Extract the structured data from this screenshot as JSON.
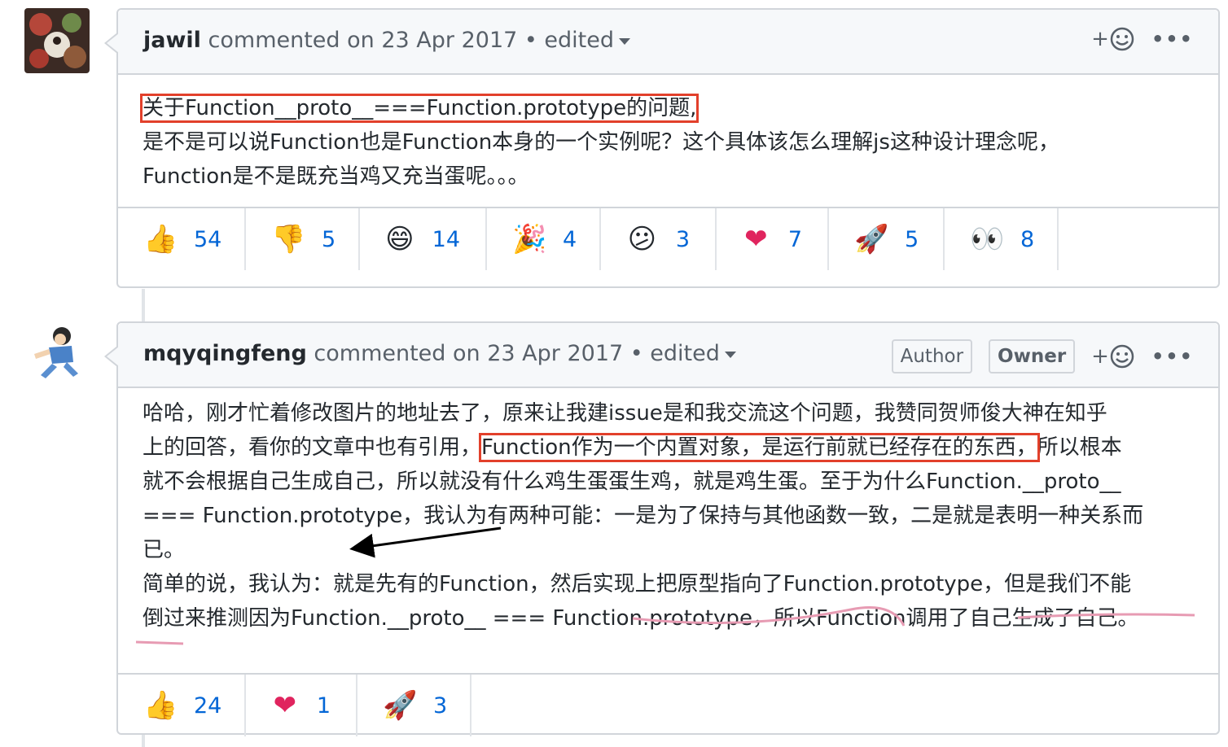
{
  "comments": [
    {
      "author": "jawil",
      "meta": "commented on 23 Apr 2017 • edited",
      "body": {
        "line1": "关于Function__proto__===Function.prototype的问题,",
        "line2": "是不是可以说Function也是Function本身的一个实例呢？这个具体该怎么理解js这种设计理念呢，",
        "line3": "Function是不是既充当鸡又充当蛋呢。。。"
      },
      "reactions": [
        {
          "emoji": "👍",
          "count": "54"
        },
        {
          "emoji": "👎",
          "count": "5"
        },
        {
          "emoji": "😄",
          "count": "14"
        },
        {
          "emoji": "🎉",
          "count": "4"
        },
        {
          "emoji": "😕",
          "count": "3"
        },
        {
          "emoji": "❤",
          "count": "7"
        },
        {
          "emoji": "🚀",
          "count": "5"
        },
        {
          "emoji": "👀",
          "count": "8"
        }
      ]
    },
    {
      "author": "mqyqingfeng",
      "meta": "commented on 23 Apr 2017 • edited",
      "badges": {
        "author": "Author",
        "owner": "Owner"
      },
      "body": {
        "l1": "哈哈，刚才忙着修改图片的地址去了，原来让我建issue是和我交流这个问题，我赞同贺师俊大神在知乎",
        "l2a": "上的回答，看你的文章中也有引用，",
        "l2b": "Function作为一个内置对象，是运行前就已经存在的东西，",
        "l2c": "所以根本",
        "l3": "就不会根据自己生成自己，所以就没有什么鸡生蛋蛋生鸡，就是鸡生蛋。至于为什么Function.__proto__",
        "l4": "=== Function.prototype，我认为有两种可能：一是为了保持与其他函数一致，二是就是表明一种关系而",
        "l5": "已。",
        "l6": "简单的说，我认为：就是先有的Function，然后实现上把原型指向了Function.prototype，但是我们不能",
        "l7": "倒过来推测因为Function.__proto__ === Function.prototype，所以Function调用了自己生成了自己。"
      },
      "reactions": [
        {
          "emoji": "👍",
          "count": "24"
        },
        {
          "emoji": "❤",
          "count": "1"
        },
        {
          "emoji": "🚀",
          "count": "3"
        }
      ]
    }
  ],
  "actions": {
    "add_reaction": "+",
    "more": "•••"
  },
  "colors": {
    "highlight": "#e2402b",
    "underline": "#e79bb3",
    "link": "#0366d6"
  }
}
